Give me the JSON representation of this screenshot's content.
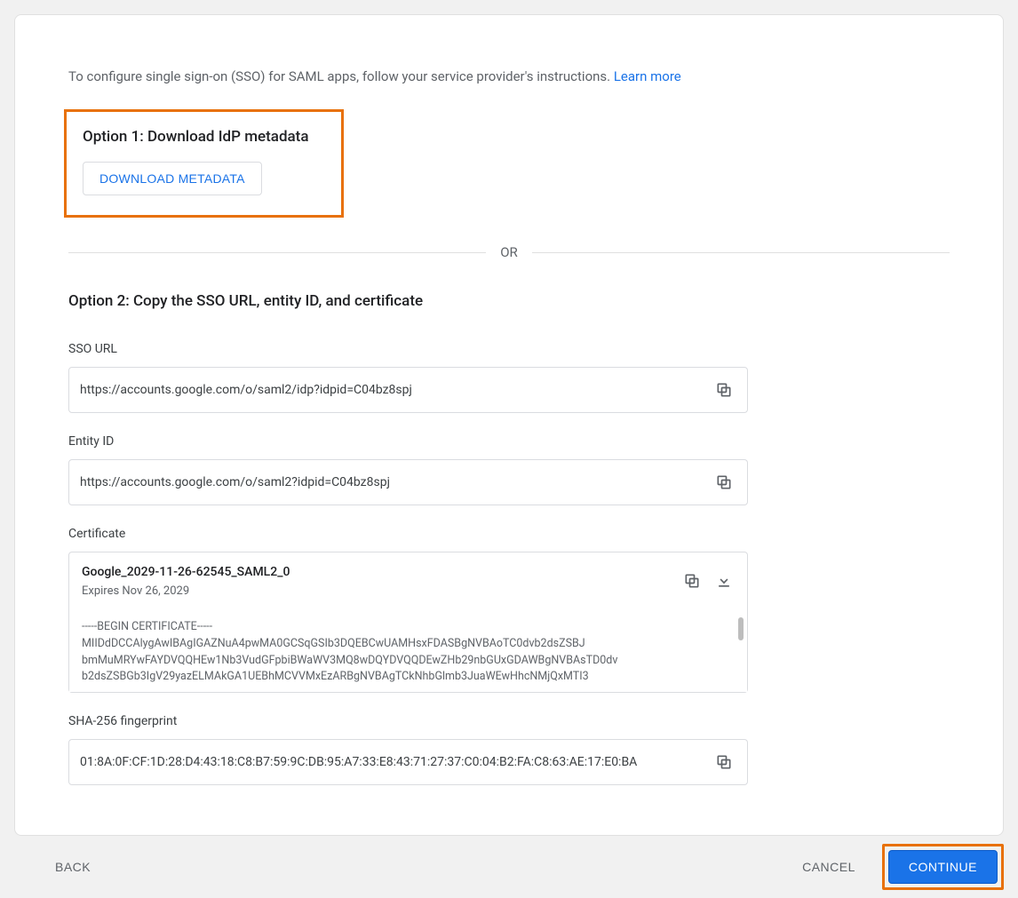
{
  "intro": {
    "text": "To configure single sign-on (SSO) for SAML apps, follow your service provider's instructions. ",
    "learn_more": "Learn more"
  },
  "option1": {
    "title": "Option 1: Download IdP metadata",
    "button": "DOWNLOAD METADATA"
  },
  "divider": "OR",
  "option2": {
    "title": "Option 2: Copy the SSO URL, entity ID, and certificate",
    "sso_url": {
      "label": "SSO URL",
      "value": "https://accounts.google.com/o/saml2/idp?idpid=C04bz8spj"
    },
    "entity_id": {
      "label": "Entity ID",
      "value": "https://accounts.google.com/o/saml2?idpid=C04bz8spj"
    },
    "certificate": {
      "label": "Certificate",
      "name": "Google_2029-11-26-62545_SAML2_0",
      "expires": "Expires Nov 26, 2029",
      "body": "-----BEGIN CERTIFICATE-----\nMIIDdDCCAlygAwIBAgIGAZNuA4pwMA0GCSqGSIb3DQEBCwUAMHsxFDASBgNVBAoTC0dvb2dsZSBJ\nbmMuMRYwFAYDVQQHEw1Nb3VudGFpbiBWaWV3MQ8wDQYDVQQDEwZHb29nbGUxGDAWBgNVBAsTD0dv\nb2dsZSBGb3IgV29yazELMAkGA1UEBhMCVVMxEzARBgNVBAgTCkNhbGlmb3JuaWEwHhcNMjQxMTI3"
    },
    "sha256": {
      "label": "SHA-256 fingerprint",
      "value": "01:8A:0F:CF:1D:28:D4:43:18:C8:B7:59:9C:DB:95:A7:33:E8:43:71:27:37:C0:04:B2:FA:C8:63:AE:17:E0:BA"
    }
  },
  "footer": {
    "back": "BACK",
    "cancel": "CANCEL",
    "continue": "CONTINUE"
  }
}
